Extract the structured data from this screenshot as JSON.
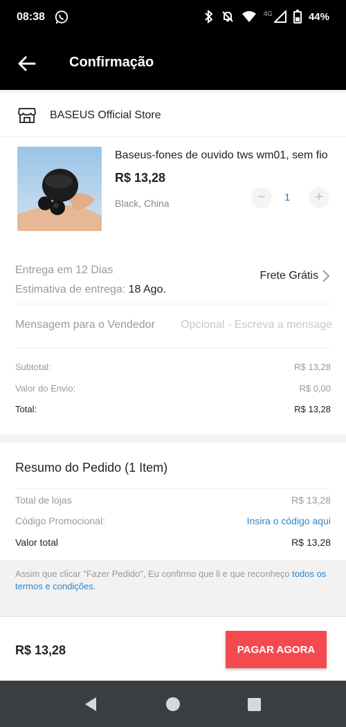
{
  "status_bar": {
    "time": "08:38",
    "network": "4G",
    "battery": "44%",
    "icons": [
      "whatsapp-icon",
      "bluetooth-icon",
      "mute-icon",
      "wifi-icon",
      "signal-icon",
      "battery-icon"
    ]
  },
  "app_bar": {
    "title": "Confirmação"
  },
  "store": {
    "name": "BASEUS Official Store"
  },
  "product": {
    "title": "Baseus-fones de ouvido tws wm01, sem fio",
    "price": "R$ 13,28",
    "variant": "Black, China",
    "quantity": "1",
    "minus": "−",
    "plus": "+"
  },
  "delivery": {
    "line1": "Entrega em 12 Dias",
    "estimate_label": "Estimativa de entrega: ",
    "estimate_date": "18 Ago.",
    "shipping": "Frete Grátis"
  },
  "message": {
    "label": "Mensagem para o Vendedor",
    "placeholder": "Opcional - Escreva a mensage"
  },
  "summary": {
    "subtotal_label": "Subtotal:",
    "subtotal_value": "R$ 13,28",
    "shipping_label": "Valor do Envio:",
    "shipping_value": "R$ 0,00",
    "total_label": "Total:",
    "total_value": "R$ 13,28"
  },
  "order_summary": {
    "title": "Resumo do Pedido (1 Item)",
    "stores_label": "Total de lojas",
    "stores_value": "R$ 13,28",
    "promo_label": "Código Promocional:",
    "promo_link": "Insira o código aqui",
    "total_label": "Valor total",
    "total_value": "R$ 13,28"
  },
  "terms": {
    "text": "Assim que clicar \"Fazer Pedido\", Eu confirmo que li e que reconheço ",
    "link": "todos os termos e condições",
    "end": "."
  },
  "pay_bar": {
    "total": "R$ 13,28",
    "button": "PAGAR AGORA"
  },
  "colors": {
    "accent_red": "#f44a4f",
    "link_blue": "#2f86c7",
    "qty_blue": "#2f7db8",
    "app_bar": "#000000"
  }
}
